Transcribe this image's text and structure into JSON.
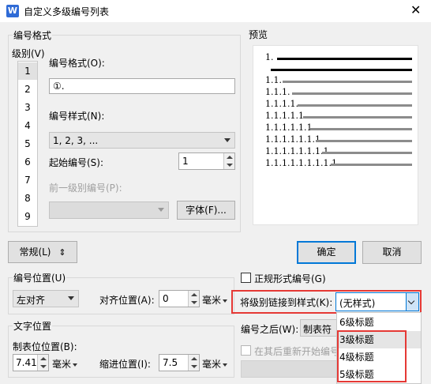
{
  "window": {
    "title": "自定义多级编号列表",
    "app_icon_glyph": "W",
    "close_glyph": "✕"
  },
  "numbering_format_group": {
    "label": "编号格式",
    "level_label": "级别(V)",
    "levels": [
      "1",
      "2",
      "3",
      "4",
      "5",
      "6",
      "7",
      "8",
      "9"
    ],
    "selected_level": "1",
    "format_label": "编号格式(O):",
    "format_value": "①.",
    "style_label": "编号样式(N):",
    "style_value": "1, 2, 3, ...",
    "start_label": "起始编号(S):",
    "start_value": "1",
    "prev_level_label": "前一级别编号(P):",
    "font_button": "字体(F)..."
  },
  "preview": {
    "label": "预览",
    "first_line": "1.",
    "rows": [
      "1.1.",
      "1.1.1.",
      "1.1.1.1.",
      "1.1.1.1.1.",
      "1.1.1.1.1.1.",
      "1.1.1.1.1.1.1.",
      "1.1.1.1.1.1.1.1.",
      "1.1.1.1.1.1.1.1.1."
    ]
  },
  "buttons": {
    "general": "常规(L)",
    "general_glyph": "⇕",
    "ok": "确定",
    "cancel": "取消"
  },
  "number_position": {
    "label": "编号位置(U)",
    "align_value": "左对齐",
    "align_pos_label": "对齐位置(A):",
    "align_pos_value": "0",
    "unit": "毫米"
  },
  "text_position": {
    "label": "文字位置",
    "tab_label": "制表位位置(B):",
    "tab_value": "7.41",
    "indent_label": "缩进位置(I):",
    "indent_value": "7.5",
    "unit": "毫米"
  },
  "legal_numbering": {
    "label": "正规形式编号(G)",
    "checked": false
  },
  "link_style": {
    "label": "将级别链接到样式(K):",
    "value": "(无样式)",
    "options": [
      "6级标题",
      "3级标题",
      "4级标题",
      "5级标题"
    ],
    "highlighted": "3级标题"
  },
  "after_number": {
    "label": "编号之后(W):",
    "value": "制表符"
  },
  "restart": {
    "label": "在其后重新开始编号"
  },
  "colors": {
    "accent": "#0078d7",
    "annotation_red": "#e53935"
  }
}
